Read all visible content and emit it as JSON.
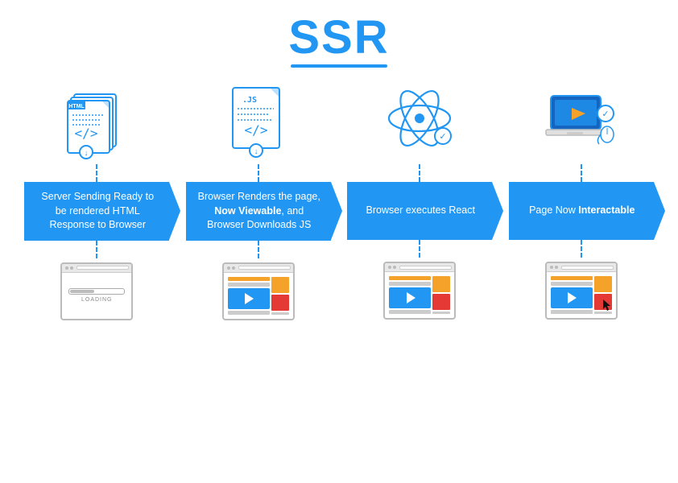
{
  "title": "SSR",
  "steps": [
    {
      "id": "step1",
      "icon": "html-file",
      "banner_text": "Server Sending Ready to be rendered HTML Response to Browser",
      "banner_bold": [],
      "state": "loading"
    },
    {
      "id": "step2",
      "icon": "js-file",
      "banner_text": "Browser Renders the page, Now Viewable, and Browser Downloads JS",
      "banner_bold": [
        "Now Viewable"
      ],
      "state": "media"
    },
    {
      "id": "step3",
      "icon": "react-atom",
      "banner_text": "Browser executes React",
      "banner_bold": [],
      "state": "media"
    },
    {
      "id": "step4",
      "icon": "laptop",
      "banner_text": "Page Now Interactable",
      "banner_bold": [
        "Interactable"
      ],
      "state": "media-cursor"
    }
  ],
  "loading_label": "LOADING",
  "colors": {
    "primary": "#2196F3",
    "accent_yellow": "#F4A22A",
    "accent_red": "#E53935"
  }
}
